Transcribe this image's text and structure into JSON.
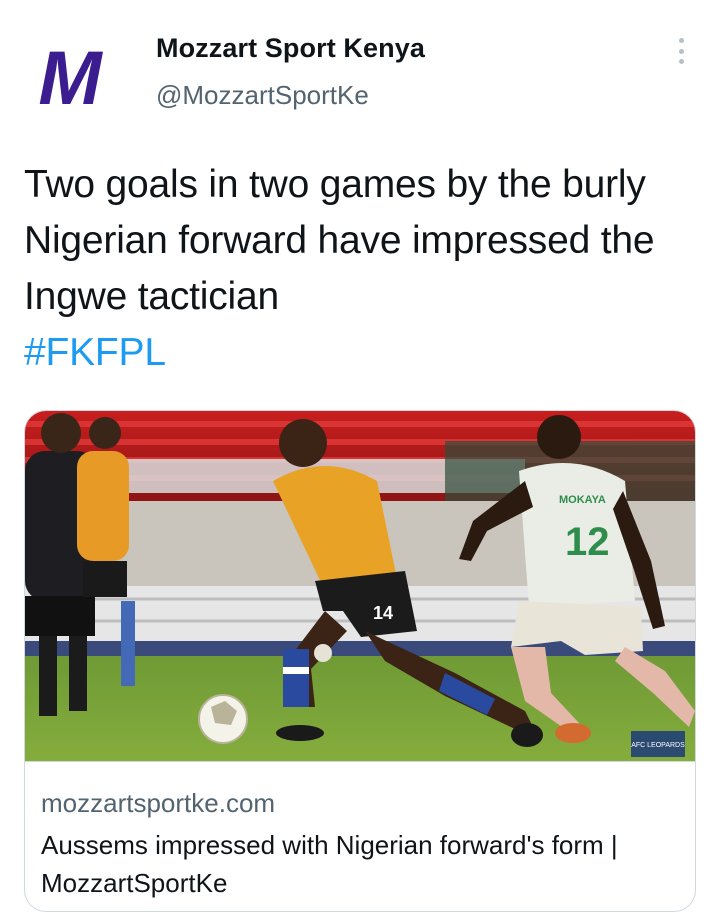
{
  "account": {
    "display_name": "Mozzart Sport Kenya",
    "handle": "@MozzartSportKe",
    "avatar_letter": "M",
    "avatar_color": "#3b1d8f"
  },
  "menu": {
    "icon": "more-vertical-icon"
  },
  "tweet": {
    "text": "Two goals in two games by the burly Nigerian forward have impressed the Ingwe tactician",
    "hashtag": "#FKFPL",
    "hashtag_color": "#1d9bf0"
  },
  "card": {
    "domain": "mozzartsportke.com",
    "title": "Aussems impressed with Nigerian forward's form | MozzartSportKe",
    "image": {
      "shirt_name": "MOKAYA",
      "shirt_number": "12",
      "player_number": "14",
      "badge_text": "AFC LEOPARDS"
    }
  }
}
